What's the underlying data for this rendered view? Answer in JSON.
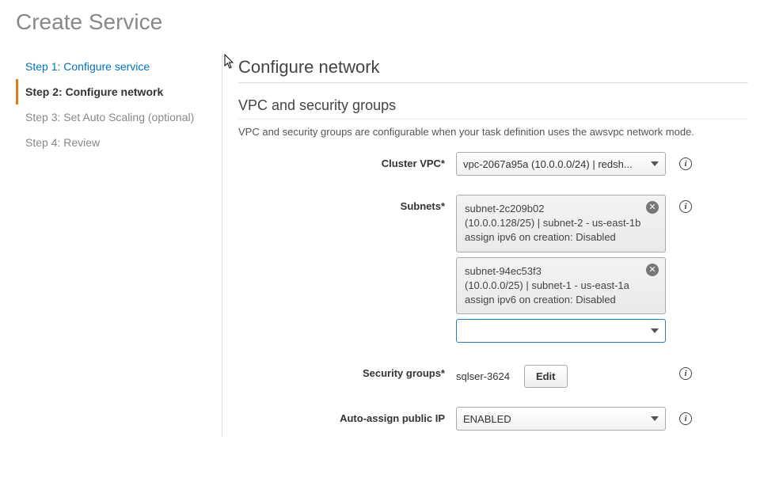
{
  "pageTitle": "Create Service",
  "steps": [
    {
      "label": "Step 1: Configure service",
      "state": "link"
    },
    {
      "label": "Step 2: Configure network",
      "state": "active"
    },
    {
      "label": "Step 3: Set Auto Scaling (optional)",
      "state": "disabled"
    },
    {
      "label": "Step 4: Review",
      "state": "disabled"
    }
  ],
  "main": {
    "heading": "Configure network",
    "subheading": "VPC and security groups",
    "description": "VPC and security groups are configurable when your task definition uses the awsvpc network mode."
  },
  "form": {
    "clusterVpc": {
      "label": "Cluster VPC*",
      "value": "vpc-2067a95a (10.0.0.0/24) | redsh..."
    },
    "subnets": {
      "label": "Subnets*",
      "items": [
        {
          "id": "subnet-2c209b02",
          "line2": "(10.0.0.128/25) | subnet-2 - us-east-1b",
          "line3": "assign ipv6 on creation: Disabled"
        },
        {
          "id": "subnet-94ec53f3",
          "line2": "(10.0.0.0/25) | subnet-1 - us-east-1a",
          "line3": "assign ipv6 on creation: Disabled"
        }
      ]
    },
    "securityGroups": {
      "label": "Security groups*",
      "value": "sqlser-3624",
      "editLabel": "Edit"
    },
    "autoAssignIp": {
      "label": "Auto-assign public IP",
      "value": "ENABLED"
    }
  }
}
